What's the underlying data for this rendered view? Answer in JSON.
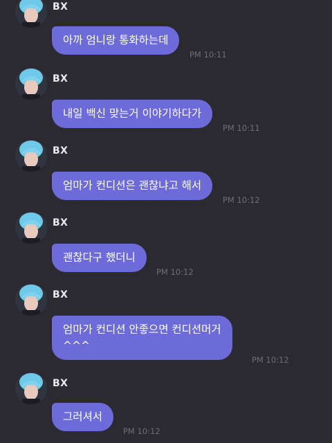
{
  "messages": [
    {
      "sender": "BX",
      "text": "아까 엄니랑 통화하는데",
      "time": "PM 10:11"
    },
    {
      "sender": "BX",
      "text": "내일 백신 맞는거 이야기하다가",
      "time": "PM 10:11"
    },
    {
      "sender": "BX",
      "text": "엄마가 컨디션은 괜찮냐고 해서",
      "time": "PM 10:12"
    },
    {
      "sender": "BX",
      "text": "괜찮다구 했더니",
      "time": "PM 10:12"
    },
    {
      "sender": "BX",
      "text": "엄마가 컨디션 안좋으면 컨디션머거\n^^^",
      "time": "PM 10:12"
    },
    {
      "sender": "BX",
      "text": "그러셔서",
      "time": "PM 10:12"
    }
  ],
  "colors": {
    "background": "#2b2a31",
    "bubble": "#6c6bd9",
    "time": "#6f6e78",
    "avatar_hair": "#6fc9e8"
  }
}
